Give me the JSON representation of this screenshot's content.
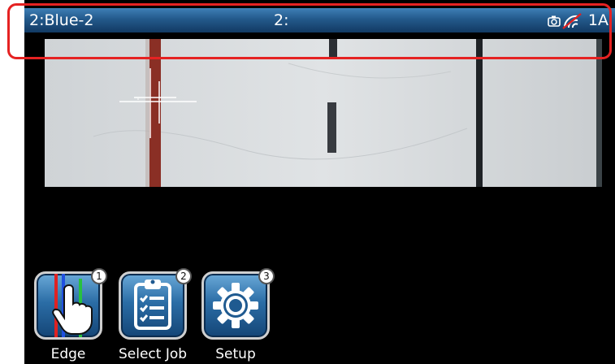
{
  "titlebar": {
    "left": "2:Blue-2",
    "center": "2:",
    "right": "1A",
    "icons": [
      "camera-icon",
      "no-signal-icon"
    ]
  },
  "camera_view": {
    "description_icons": [
      "crosshair-icon"
    ]
  },
  "toolbar": {
    "buttons": [
      {
        "label": "Edge",
        "badge": "1",
        "icon": "edge-hand-icon"
      },
      {
        "label": "Select Job",
        "badge": "2",
        "icon": "clipboard-checklist-icon"
      },
      {
        "label": "Setup",
        "badge": "3",
        "icon": "gear-icon"
      }
    ]
  },
  "colors": {
    "titlebar": "#23598b",
    "highlight": "#e52222",
    "button_face": "#2b6da6",
    "screen_bg": "#000000"
  }
}
